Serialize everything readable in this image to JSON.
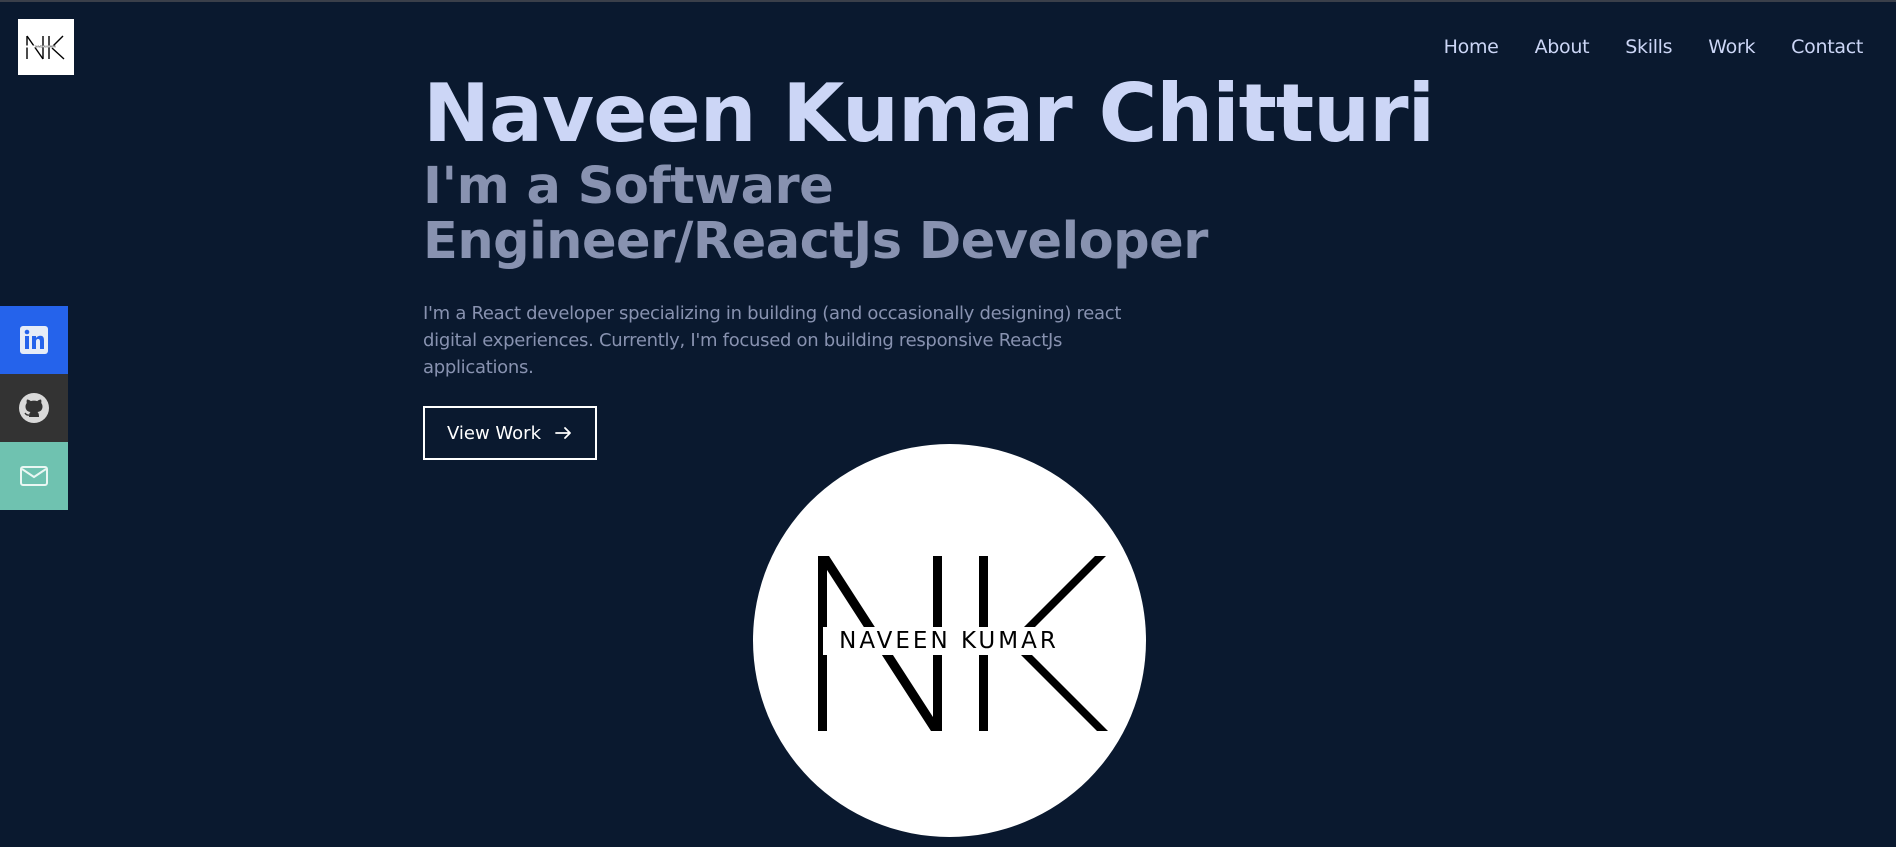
{
  "nav": {
    "items": [
      {
        "label": "Home"
      },
      {
        "label": "About"
      },
      {
        "label": "Skills"
      },
      {
        "label": "Work"
      },
      {
        "label": "Contact"
      }
    ]
  },
  "hero": {
    "name": "Naveen Kumar Chitturi",
    "tagline": "I'm a Software Engineer/ReactJs Developer",
    "description": "I'm a React developer specializing in building (and occasionally designing) react digital experiences. Currently, I'm focused on building responsive ReactJs applications.",
    "button_label": "View Work",
    "button_icon": "arrow-right-icon"
  },
  "social": [
    {
      "name": "linkedin",
      "icon": "linkedin-icon",
      "color": "#2563eb"
    },
    {
      "name": "github",
      "icon": "github-icon",
      "color": "#333333"
    },
    {
      "name": "email",
      "icon": "mail-icon",
      "color": "#6fc2b0"
    }
  ],
  "logo": {
    "monogram": "NK",
    "text": "NAVEEN KUMAR"
  },
  "colors": {
    "background": "#0a192f",
    "heading": "#ccd6f6",
    "muted": "#8892b0"
  }
}
